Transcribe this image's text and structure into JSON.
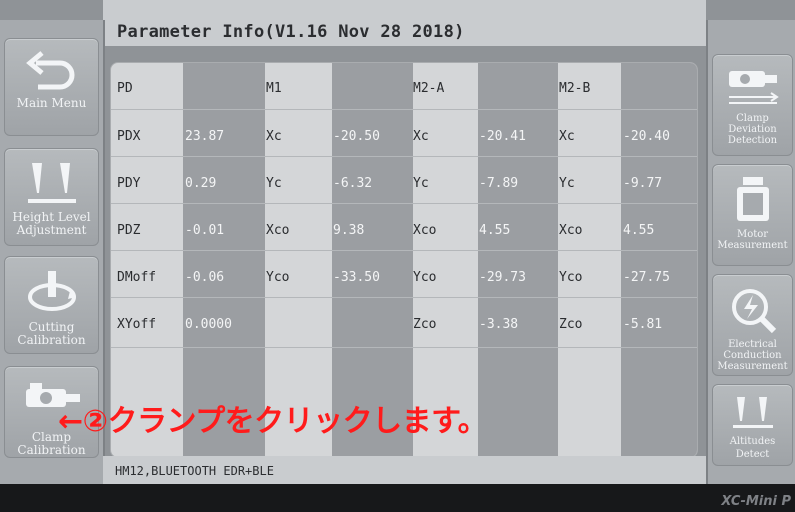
{
  "header": {
    "title": "Parameter Info(V1.16 Nov 28 2018)"
  },
  "left_menu": [
    {
      "label": "Main Menu",
      "icon": "return-arrow-icon"
    },
    {
      "label": "Height Level Adjustment",
      "icon": "height-probe-icon"
    },
    {
      "label": "Cutting Calibration",
      "icon": "rotation-calibration-icon"
    },
    {
      "label": "Clamp Calibration",
      "icon": "clamp-icon"
    }
  ],
  "right_menu": [
    {
      "label": "Clamp Deviation Detection",
      "icon": "clamp-deviation-icon"
    },
    {
      "label": "Motor Measurement",
      "icon": "motor-icon"
    },
    {
      "label": "Electrical Conduction Measurement",
      "icon": "electrical-search-icon"
    },
    {
      "label": "Altitudes Detect",
      "icon": "altitude-probe-icon"
    }
  ],
  "table": {
    "columns": [
      {
        "header": "PD",
        "rows": [
          [
            "PDX",
            "23.87"
          ],
          [
            "PDY",
            "0.29"
          ],
          [
            "PDZ",
            "-0.01"
          ],
          [
            "DMoff",
            "-0.06"
          ],
          [
            "XYoff",
            "0.0000"
          ]
        ]
      },
      {
        "header": "M1",
        "rows": [
          [
            "Xc",
            "-20.50"
          ],
          [
            "Yc",
            "-6.32"
          ],
          [
            "Xco",
            "9.38"
          ],
          [
            "Yco",
            "-33.50"
          ],
          [
            "",
            ""
          ]
        ]
      },
      {
        "header": "M2-A",
        "rows": [
          [
            "Xc",
            "-20.41"
          ],
          [
            "Yc",
            "-7.89"
          ],
          [
            "Xco",
            "4.55"
          ],
          [
            "Yco",
            "-29.73"
          ],
          [
            "Zco",
            "-3.38"
          ]
        ]
      },
      {
        "header": "M2-B",
        "rows": [
          [
            "Xc",
            "-20.40"
          ],
          [
            "Yc",
            "-9.77"
          ],
          [
            "Xco",
            "4.55"
          ],
          [
            "Yco",
            "-27.75"
          ],
          [
            "Zco",
            "-5.81"
          ]
        ]
      }
    ]
  },
  "footer": {
    "text": "HM12,BLUETOOTH EDR+BLE"
  },
  "annotation": {
    "text": "←②クランプをクリックします。"
  },
  "device": {
    "brand": "XC-Mini P"
  },
  "colors": {
    "annotation": "#ff1b1b",
    "panel": "#d4d6d8",
    "value_column": "#9b9ea2"
  }
}
